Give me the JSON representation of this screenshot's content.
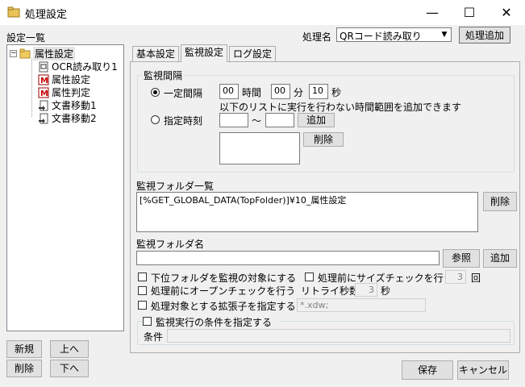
{
  "window": {
    "title": "処理設定",
    "minimize": "—",
    "maximize": "☐",
    "close": "✕"
  },
  "left": {
    "list_label": "設定一覧",
    "tree_root": "属性設定",
    "tree_items": [
      "OCR読み取り1",
      "属性設定",
      "属性判定",
      "文書移動1",
      "文書移動2"
    ],
    "btn_new": "新規",
    "btn_up": "上へ",
    "btn_delete": "削除",
    "btn_down": "下へ"
  },
  "header": {
    "process_name_label": "処理名",
    "process_name_value": "QRコード読み取り",
    "add_process_btn": "処理追加"
  },
  "tabs": [
    "基本設定",
    "監視設定",
    "ログ設定"
  ],
  "monitor": {
    "interval_group": "監視間隔",
    "fixed_interval": "一定間隔",
    "hours": "00",
    "hours_label": "時間",
    "minutes": "00",
    "minutes_label": "分",
    "seconds": "10",
    "seconds_label": "秒",
    "note": "以下のリストに実行を行わない時間範囲を追加できます",
    "specified_time": "指定時刻",
    "tilde": "～",
    "add_btn": "追加",
    "delete_btn": "削除"
  },
  "folders": {
    "list_label": "監視フォルダ一覧",
    "list_value": "[%GET_GLOBAL_DATA(TopFolder)]¥10_属性設定",
    "delete_btn": "削除",
    "name_label": "監視フォルダ名",
    "browse_btn": "参照",
    "add_btn": "追加"
  },
  "options": {
    "subfolder": "下位フォルダを監視の対象にする",
    "size_check": "処理前にサイズチェックを行う",
    "size_check_count": "3",
    "size_check_unit": "回",
    "open_check": "処理前にオープンチェックを行う",
    "retry_label": "リトライ秒数",
    "retry_value": "3",
    "retry_unit": "秒",
    "extension": "処理対象とする拡張子を指定する",
    "extension_value": "*.xdw;",
    "condition_group": "監視実行の条件を指定する",
    "condition_label": "条件"
  },
  "footer": {
    "save": "保存",
    "cancel": "キャンセル"
  }
}
